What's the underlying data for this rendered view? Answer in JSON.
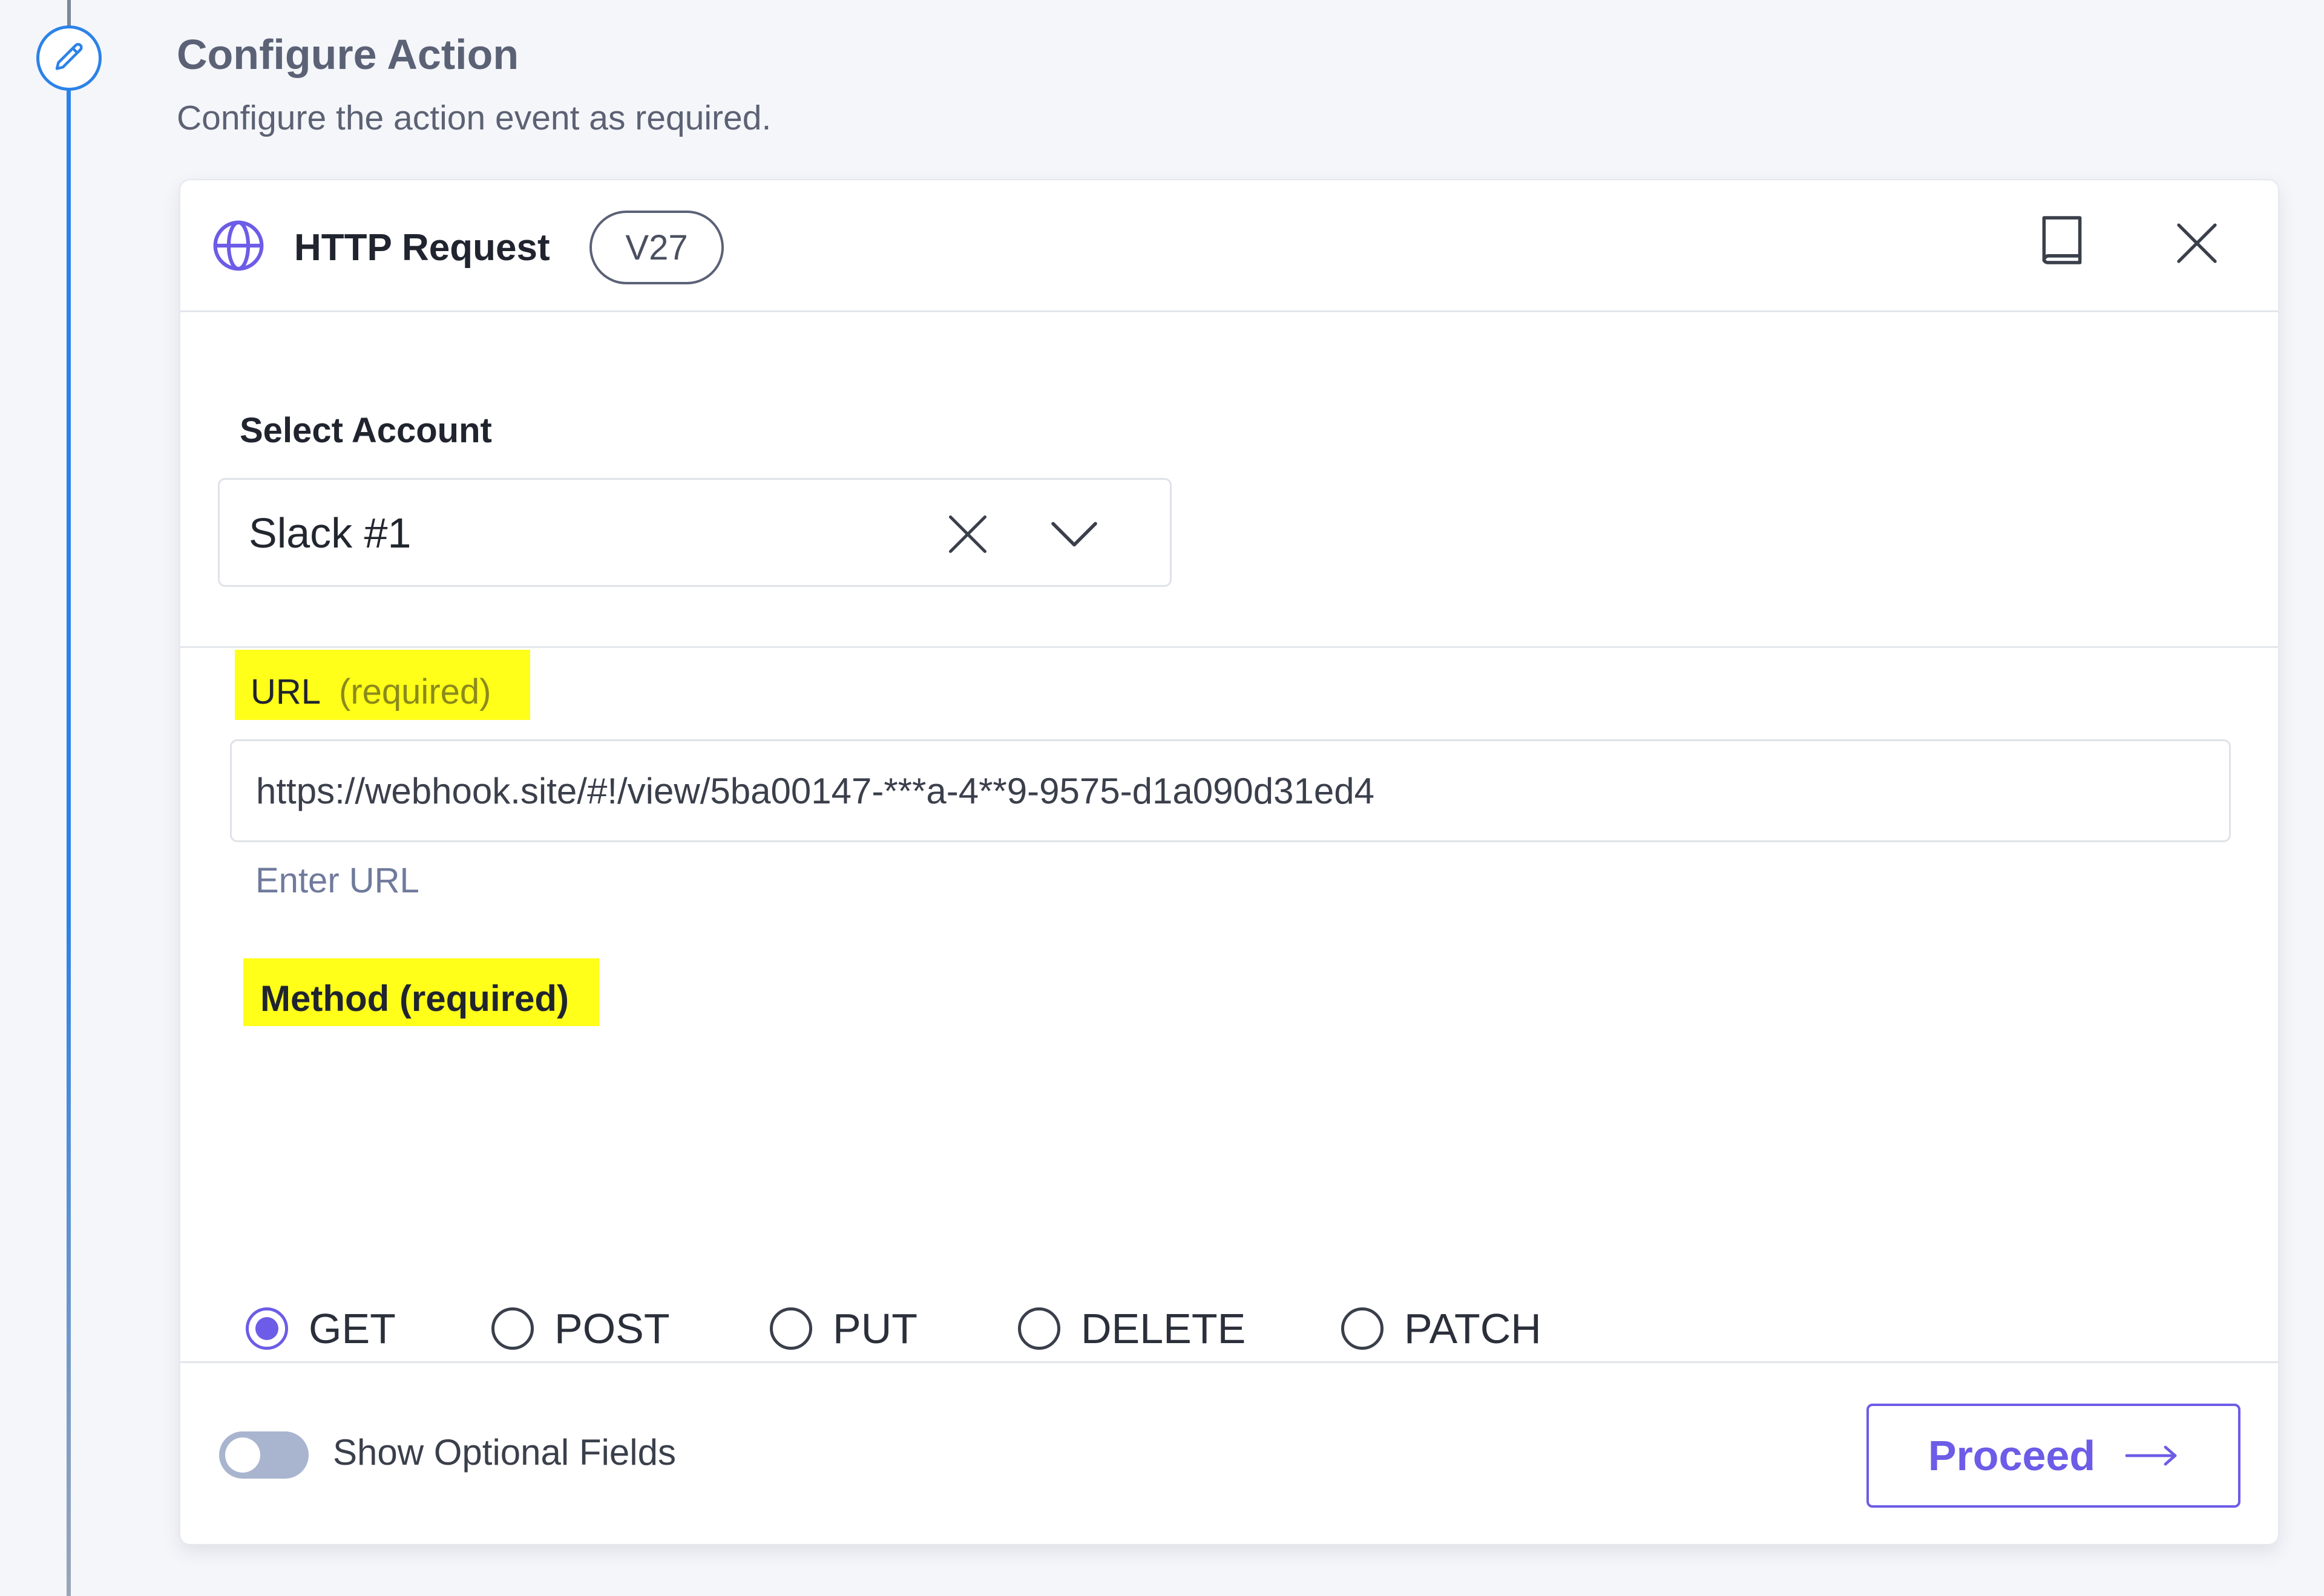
{
  "section": {
    "title": "Configure Action",
    "subtitle": "Configure the action event as required."
  },
  "card": {
    "app_name": "HTTP Request",
    "version": "V27",
    "icons": {
      "app": "globe-icon",
      "docs": "book-icon",
      "close": "close-icon",
      "step": "pencil-icon"
    },
    "account": {
      "label": "Select Account",
      "value": "Slack #1"
    },
    "url": {
      "label": "URL",
      "required": "(required)",
      "value": "https://webhook.site/#!/view/5ba00147-***a-4**9-9575-d1a090d31ed4",
      "hint": "Enter URL"
    },
    "method": {
      "label": "Method (required)",
      "options": [
        "GET",
        "POST",
        "PUT",
        "DELETE",
        "PATCH"
      ],
      "selected": "GET"
    },
    "footer": {
      "toggle_label": "Show Optional Fields",
      "toggle_on": false,
      "proceed_label": "Proceed"
    }
  },
  "colors": {
    "accent": "#6c5ce7",
    "timeline": "#2c82e8",
    "highlight": "#ffff1a"
  }
}
